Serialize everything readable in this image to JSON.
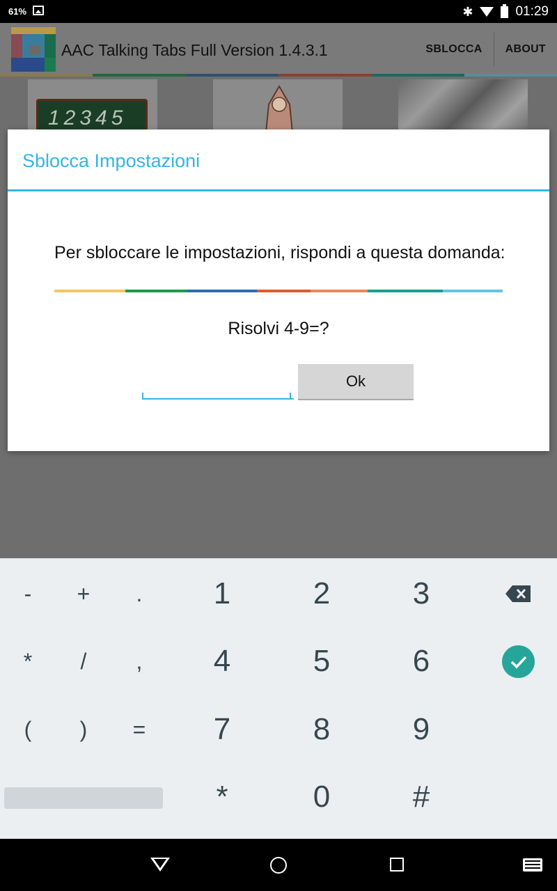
{
  "status_bar": {
    "battery_percent": "61%",
    "time": "01:29",
    "icons": [
      "image-icon",
      "bluetooth-icon",
      "wifi-icon",
      "battery-icon"
    ]
  },
  "app_bar": {
    "title": "AAC Talking Tabs Full Version 1.4.3.1",
    "actions": [
      "SBLOCCA",
      "ABOUT"
    ],
    "stripe_colors": [
      "#f7c65f",
      "#1a9a52",
      "#2e6bb0",
      "#e05a2b",
      "#e88a5a",
      "#18a08c",
      "#63c4e8"
    ]
  },
  "grid": {
    "tile1_text": "12345"
  },
  "dialog": {
    "title": "Sblocca Impostazioni",
    "message": "Per sbloccare le impostazioni, rispondi a questa domanda:",
    "question": "Risolvi 4-9=?",
    "input_value": "",
    "ok_label": "Ok",
    "accent_color": "#33b5e5"
  },
  "keyboard": {
    "row1": [
      "-",
      "+",
      ".",
      "1",
      "2",
      "3"
    ],
    "row2": [
      "*",
      "/",
      ",",
      "4",
      "5",
      "6"
    ],
    "row3": [
      "(",
      ")",
      "=",
      "7",
      "8",
      "9"
    ],
    "row4": [
      "*",
      "0",
      "#"
    ],
    "done_color": "#26a69a"
  }
}
